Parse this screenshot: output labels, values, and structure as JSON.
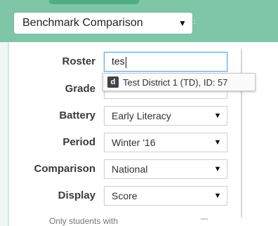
{
  "header": {
    "report_selector": {
      "value": "Benchmark Comparison",
      "caret": "▼"
    },
    "dots": ":"
  },
  "form": {
    "roster": {
      "label": "Roster",
      "value": "tes"
    },
    "grade": {
      "label": "Grade",
      "value": ""
    },
    "battery": {
      "label": "Battery",
      "value": "Early Literacy",
      "caret": "▼"
    },
    "period": {
      "label": "Period",
      "value": "Winter '16",
      "caret": "▼"
    },
    "comparison": {
      "label": "Comparison",
      "value": "National",
      "caret": "▼"
    },
    "display": {
      "label": "Display",
      "value": "Score",
      "caret": "▼"
    }
  },
  "autocomplete": {
    "badge": "d",
    "text": "Test District 1 (TD), ID: 57"
  },
  "footer_partial": {
    "text": "Only students with"
  },
  "colors": {
    "header_green": "#7fc6a8",
    "focus_blue": "#5aa9e6"
  }
}
